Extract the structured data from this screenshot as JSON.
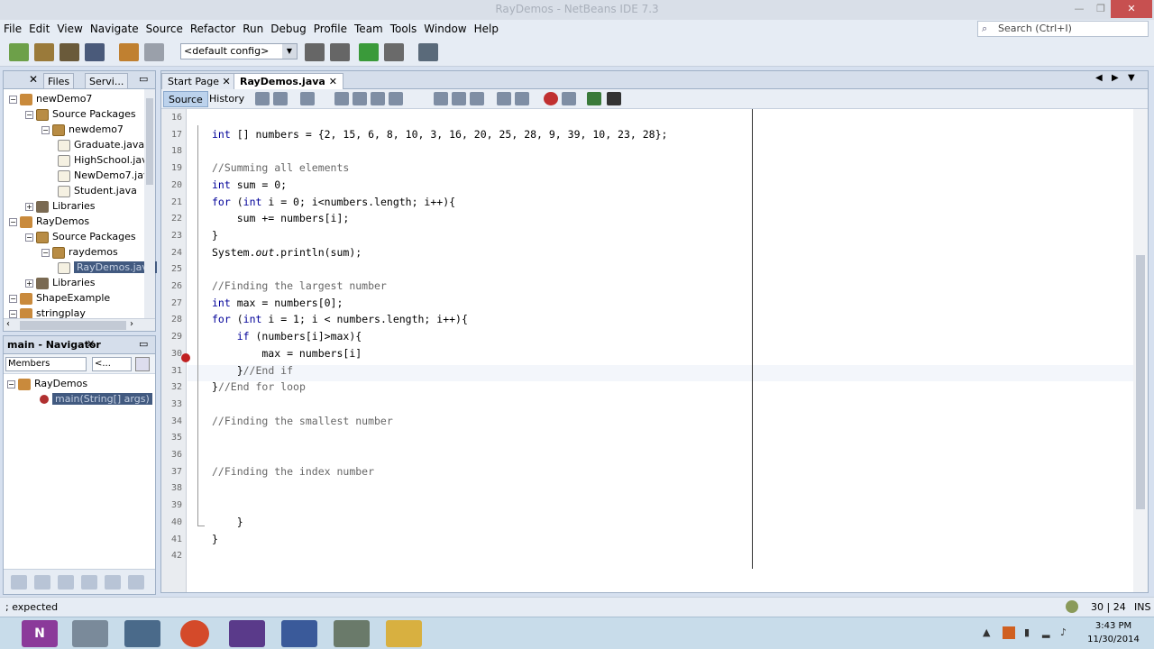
{
  "window": {
    "title": "RayDemos - NetBeans IDE 7.3"
  },
  "menu": [
    "File",
    "Edit",
    "View",
    "Navigate",
    "Source",
    "Refactor",
    "Run",
    "Debug",
    "Profile",
    "Team",
    "Tools",
    "Window",
    "Help"
  ],
  "search": {
    "placeholder": "Search (Ctrl+I)"
  },
  "toolbar": {
    "config": "<default config>"
  },
  "projects_panel": {
    "tabs": [
      "Files",
      "Servi..."
    ],
    "tree": [
      {
        "label": "newDemo7",
        "level": 0,
        "icon": "project-icon"
      },
      {
        "label": "Source Packages",
        "level": 1,
        "icon": "package-icon"
      },
      {
        "label": "newdemo7",
        "level": 2,
        "icon": "package-icon"
      },
      {
        "label": "Graduate.java",
        "level": 3,
        "icon": "java-file-icon"
      },
      {
        "label": "HighSchool.java",
        "level": 3,
        "icon": "java-file-icon"
      },
      {
        "label": "NewDemo7.java",
        "level": 3,
        "icon": "java-file-icon"
      },
      {
        "label": "Student.java",
        "level": 3,
        "icon": "java-file-icon"
      },
      {
        "label": "Libraries",
        "level": 1,
        "icon": "library-icon"
      },
      {
        "label": "RayDemos",
        "level": 0,
        "icon": "project-icon"
      },
      {
        "label": "Source Packages",
        "level": 1,
        "icon": "package-icon"
      },
      {
        "label": "raydemos",
        "level": 2,
        "icon": "package-icon"
      },
      {
        "label": "RayDemos.java",
        "level": 3,
        "icon": "java-file-icon",
        "selected": true
      },
      {
        "label": "Libraries",
        "level": 1,
        "icon": "library-icon"
      },
      {
        "label": "ShapeExample",
        "level": 0,
        "icon": "project-icon"
      },
      {
        "label": "stringplay",
        "level": 0,
        "icon": "project-icon"
      }
    ]
  },
  "navigator": {
    "title": "main - Navigator",
    "filter": "Members",
    "filter2": "<...",
    "tree_root": "RayDemos",
    "tree_child": "main(String[] args)"
  },
  "editor": {
    "tabs": [
      "Start Page",
      "RayDemos.java"
    ],
    "source_label": "Source",
    "history_label": "History",
    "lines": [
      {
        "n": "16",
        "text": ""
      },
      {
        "n": "17",
        "text": "int [] numbers = {2, 15, 6, 8, 10, 3, 16, 20, 25, 28, 9, 39, 10, 23, 28};"
      },
      {
        "n": "18",
        "text": ""
      },
      {
        "n": "19",
        "text": "//Summing all elements"
      },
      {
        "n": "20",
        "text": "int sum = 0;"
      },
      {
        "n": "21",
        "text": "for (int i = 0; i<numbers.length; i++){"
      },
      {
        "n": "22",
        "text": "    sum += numbers[i];"
      },
      {
        "n": "23",
        "text": "}"
      },
      {
        "n": "24",
        "text": "System.out.println(sum);"
      },
      {
        "n": "25",
        "text": ""
      },
      {
        "n": "26",
        "text": "//Finding the largest number"
      },
      {
        "n": "27",
        "text": "int max = numbers[0];"
      },
      {
        "n": "28",
        "text": "for (int i = 1; i < numbers.length; i++){"
      },
      {
        "n": "29",
        "text": "    if (numbers[i]>max){"
      },
      {
        "n": "30",
        "text": "        max = numbers[i]"
      },
      {
        "n": "31",
        "text": "    }//End if"
      },
      {
        "n": "32",
        "text": "}//End for loop"
      },
      {
        "n": "33",
        "text": ""
      },
      {
        "n": "34",
        "text": "//Finding the smallest number"
      },
      {
        "n": "35",
        "text": ""
      },
      {
        "n": "36",
        "text": ""
      },
      {
        "n": "37",
        "text": "//Finding the index number"
      },
      {
        "n": "38",
        "text": ""
      },
      {
        "n": "39",
        "text": ""
      },
      {
        "n": "40",
        "text": "    }"
      },
      {
        "n": "41",
        "text": "}"
      },
      {
        "n": "42",
        "text": ""
      }
    ]
  },
  "status": {
    "message": "; expected",
    "position": "30 | 24",
    "mode": "INS"
  },
  "taskbar": {
    "time": "3:43 PM",
    "date": "11/30/2014"
  },
  "colors": {
    "keyword": "#000099",
    "comment": "#666666",
    "selection": "#425a80"
  }
}
